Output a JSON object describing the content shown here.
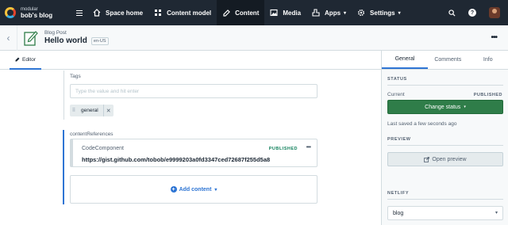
{
  "space": {
    "org": "modular",
    "name": "bob's blog"
  },
  "nav": {
    "items": [
      {
        "label": "Space home",
        "icon": "home-icon"
      },
      {
        "label": "Content model",
        "icon": "content-model-icon"
      },
      {
        "label": "Content",
        "icon": "content-icon",
        "active": true
      },
      {
        "label": "Media",
        "icon": "media-icon"
      },
      {
        "label": "Apps",
        "icon": "apps-icon",
        "has_dropdown": true
      },
      {
        "label": "Settings",
        "icon": "gear-icon",
        "has_dropdown": true
      }
    ],
    "help": "?"
  },
  "entry": {
    "content_type": "Blog Post",
    "title": "Hello world",
    "locale_badge": "en-US"
  },
  "editor": {
    "tab_label": "Editor",
    "tags": {
      "label": "Tags",
      "placeholder": "Type the value and hit enter",
      "values": [
        "general"
      ]
    },
    "references": {
      "label": "contentReferences",
      "card": {
        "content_type": "CodeComponent",
        "status": "PUBLISHED",
        "url": "https://gist.github.com/tobob/e9999203a0fd3347ced72687f255d5a8"
      },
      "add_label": "Add content"
    }
  },
  "sidebar": {
    "tabs": [
      "General",
      "Comments",
      "Info"
    ],
    "status_heading": "STATUS",
    "current_label": "Current",
    "current_status": "PUBLISHED",
    "change_status_label": "Change status",
    "last_saved": "Last saved a few seconds ago",
    "preview_heading": "PREVIEW",
    "open_preview_label": "Open preview",
    "netlify_heading": "NETLIFY",
    "netlify_selected": "blog"
  },
  "colors": {
    "nav_bg": "#1f2833",
    "accent_blue": "#2e75d4",
    "publish_green": "#2f7d49",
    "published_text": "#0e7f5a"
  }
}
